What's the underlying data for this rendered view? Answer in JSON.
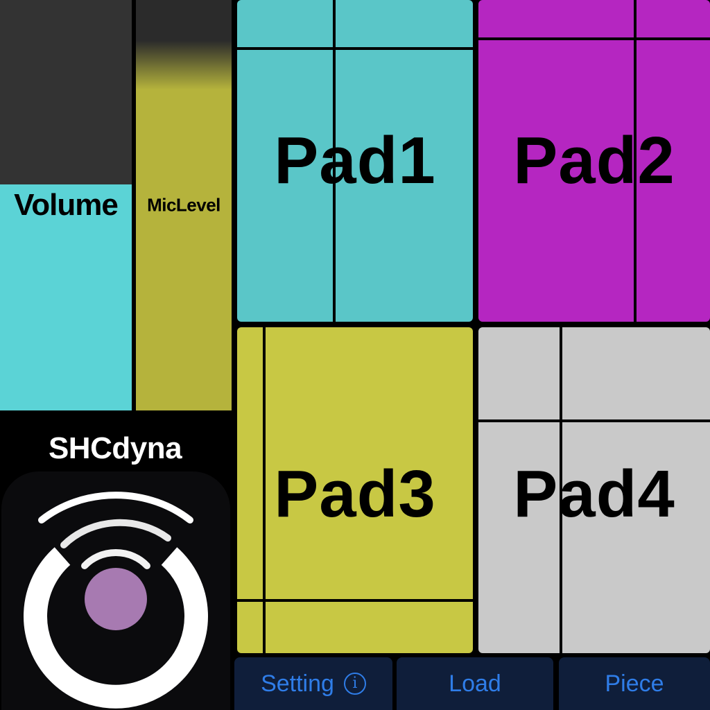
{
  "sliders": {
    "volume": {
      "label": "Volume",
      "level": 0.55,
      "fill_color": "#5bd3d6",
      "track_color": "#333333"
    },
    "mic_level": {
      "label": "MicLevel",
      "level": 0.9,
      "fill_color": "#b5b33c",
      "track_color": "#2b2b2b"
    }
  },
  "pads": [
    {
      "label": "Pad1",
      "color": "#5ac6c8"
    },
    {
      "label": "Pad2",
      "color": "#b526c1"
    },
    {
      "label": "Pad3",
      "color": "#c8c844"
    },
    {
      "label": "Pad4",
      "color": "#c9c9c9"
    }
  ],
  "app": {
    "title": "SHCdyna",
    "logo_icon": "dynamics-wave-logo-icon",
    "logo_dot_color": "#a77ab1"
  },
  "buttons": {
    "setting": {
      "label": "Setting",
      "icon": "info-icon",
      "icon_glyph": "i"
    },
    "load": {
      "label": "Load"
    },
    "piece": {
      "label": "Piece"
    }
  },
  "colors": {
    "button_bg": "#0f1e3a",
    "button_text": "#2f7de8"
  }
}
